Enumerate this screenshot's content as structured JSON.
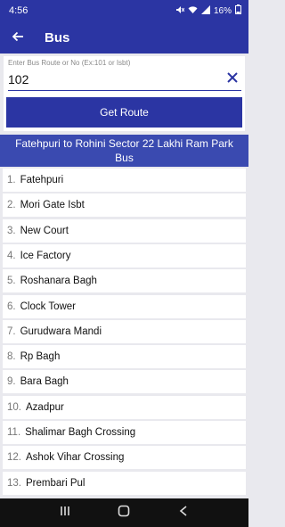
{
  "status_bar": {
    "time": "4:56",
    "battery": "16%"
  },
  "app_bar": {
    "title": "Bus",
    "back_icon": "arrow-left-icon"
  },
  "search": {
    "label": "Enter Bus Route or No (Ex:101 or Isbt)",
    "value": "102",
    "clear_icon": "close-icon"
  },
  "button": {
    "label": "Get Route"
  },
  "route_title": "Fatehpuri to Rohini Sector 22 Lakhi Ram Park Bus",
  "stops": [
    {
      "num": "1.",
      "name": "Fatehpuri"
    },
    {
      "num": "2.",
      "name": "Mori Gate Isbt"
    },
    {
      "num": "3.",
      "name": "New Court"
    },
    {
      "num": "4.",
      "name": "Ice Factory"
    },
    {
      "num": "5.",
      "name": "Roshanara Bagh"
    },
    {
      "num": "6.",
      "name": "Clock Tower"
    },
    {
      "num": "7.",
      "name": "Gurudwara Mandi"
    },
    {
      "num": "8.",
      "name": "Rp Bagh"
    },
    {
      "num": "9.",
      "name": "Bara Bagh"
    },
    {
      "num": "10.",
      "name": "Azadpur"
    },
    {
      "num": "11.",
      "name": "Shalimar Bagh Crossing"
    },
    {
      "num": "12.",
      "name": "Ashok Vihar Crossing"
    },
    {
      "num": "13.",
      "name": "Prembari Pul"
    }
  ],
  "colors": {
    "primary": "#2b35a3",
    "header": "#3a4ab0",
    "background": "#e9e9ee"
  }
}
